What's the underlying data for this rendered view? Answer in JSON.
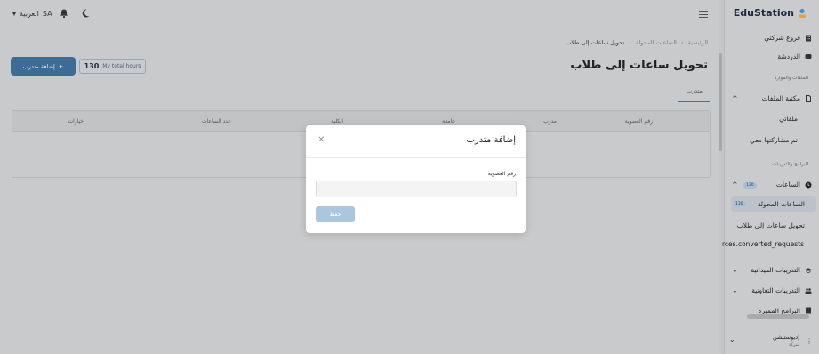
{
  "topbar": {
    "language_label": "العربية",
    "language_code": "SA"
  },
  "breadcrumb": {
    "home": "الرئيسية",
    "converted_hours": "الساعات المحولة",
    "current": "تحويل ساعات إلى طلاب"
  },
  "page": {
    "title": "تحويل ساعات إلى طلاب",
    "add_trainer_label": "إضافة متدرب",
    "hours_value": "130",
    "hours_label": "My total hours",
    "tab_trainer": "متدرب"
  },
  "table": {
    "columns": [
      "رقم العضوية",
      "مدرب",
      "جامعة",
      "الكلية",
      "عدد الساعات",
      "خيارات"
    ]
  },
  "sidebar": {
    "brand": "EduStation",
    "company_branches": "فروع شركتي",
    "chat": "الدردشة",
    "files_section": "الملفات والموارد",
    "file_library": "مكتبة الملفات",
    "my_files": "ملفاتي",
    "shared_with_me": "تم مشاركتها معي",
    "programs_section": "البرامج والتدريبات",
    "hours": "الساعات",
    "hours_badge": "130",
    "converted_hours": "الساعات المحولة",
    "converted_badge": "130",
    "convert_to_students": "تحويل ساعات إلى طلاب",
    "missing_key": "rces.converted_requests",
    "field_trainings": "التدريبات الميدانية",
    "coop_trainings": "التدريبات التعاونية",
    "partial_item": "البرامج المميزة",
    "user_name": "إديوستيشن",
    "user_role": "شركة"
  },
  "modal": {
    "title": "إضافة متدرب",
    "field_label": "رقم العضوية",
    "field_value": "",
    "save_label": "حفظ"
  },
  "colors": {
    "primary": "#3e6a96",
    "save_button": "#a9c7df",
    "overlay": "#c9cacc"
  }
}
